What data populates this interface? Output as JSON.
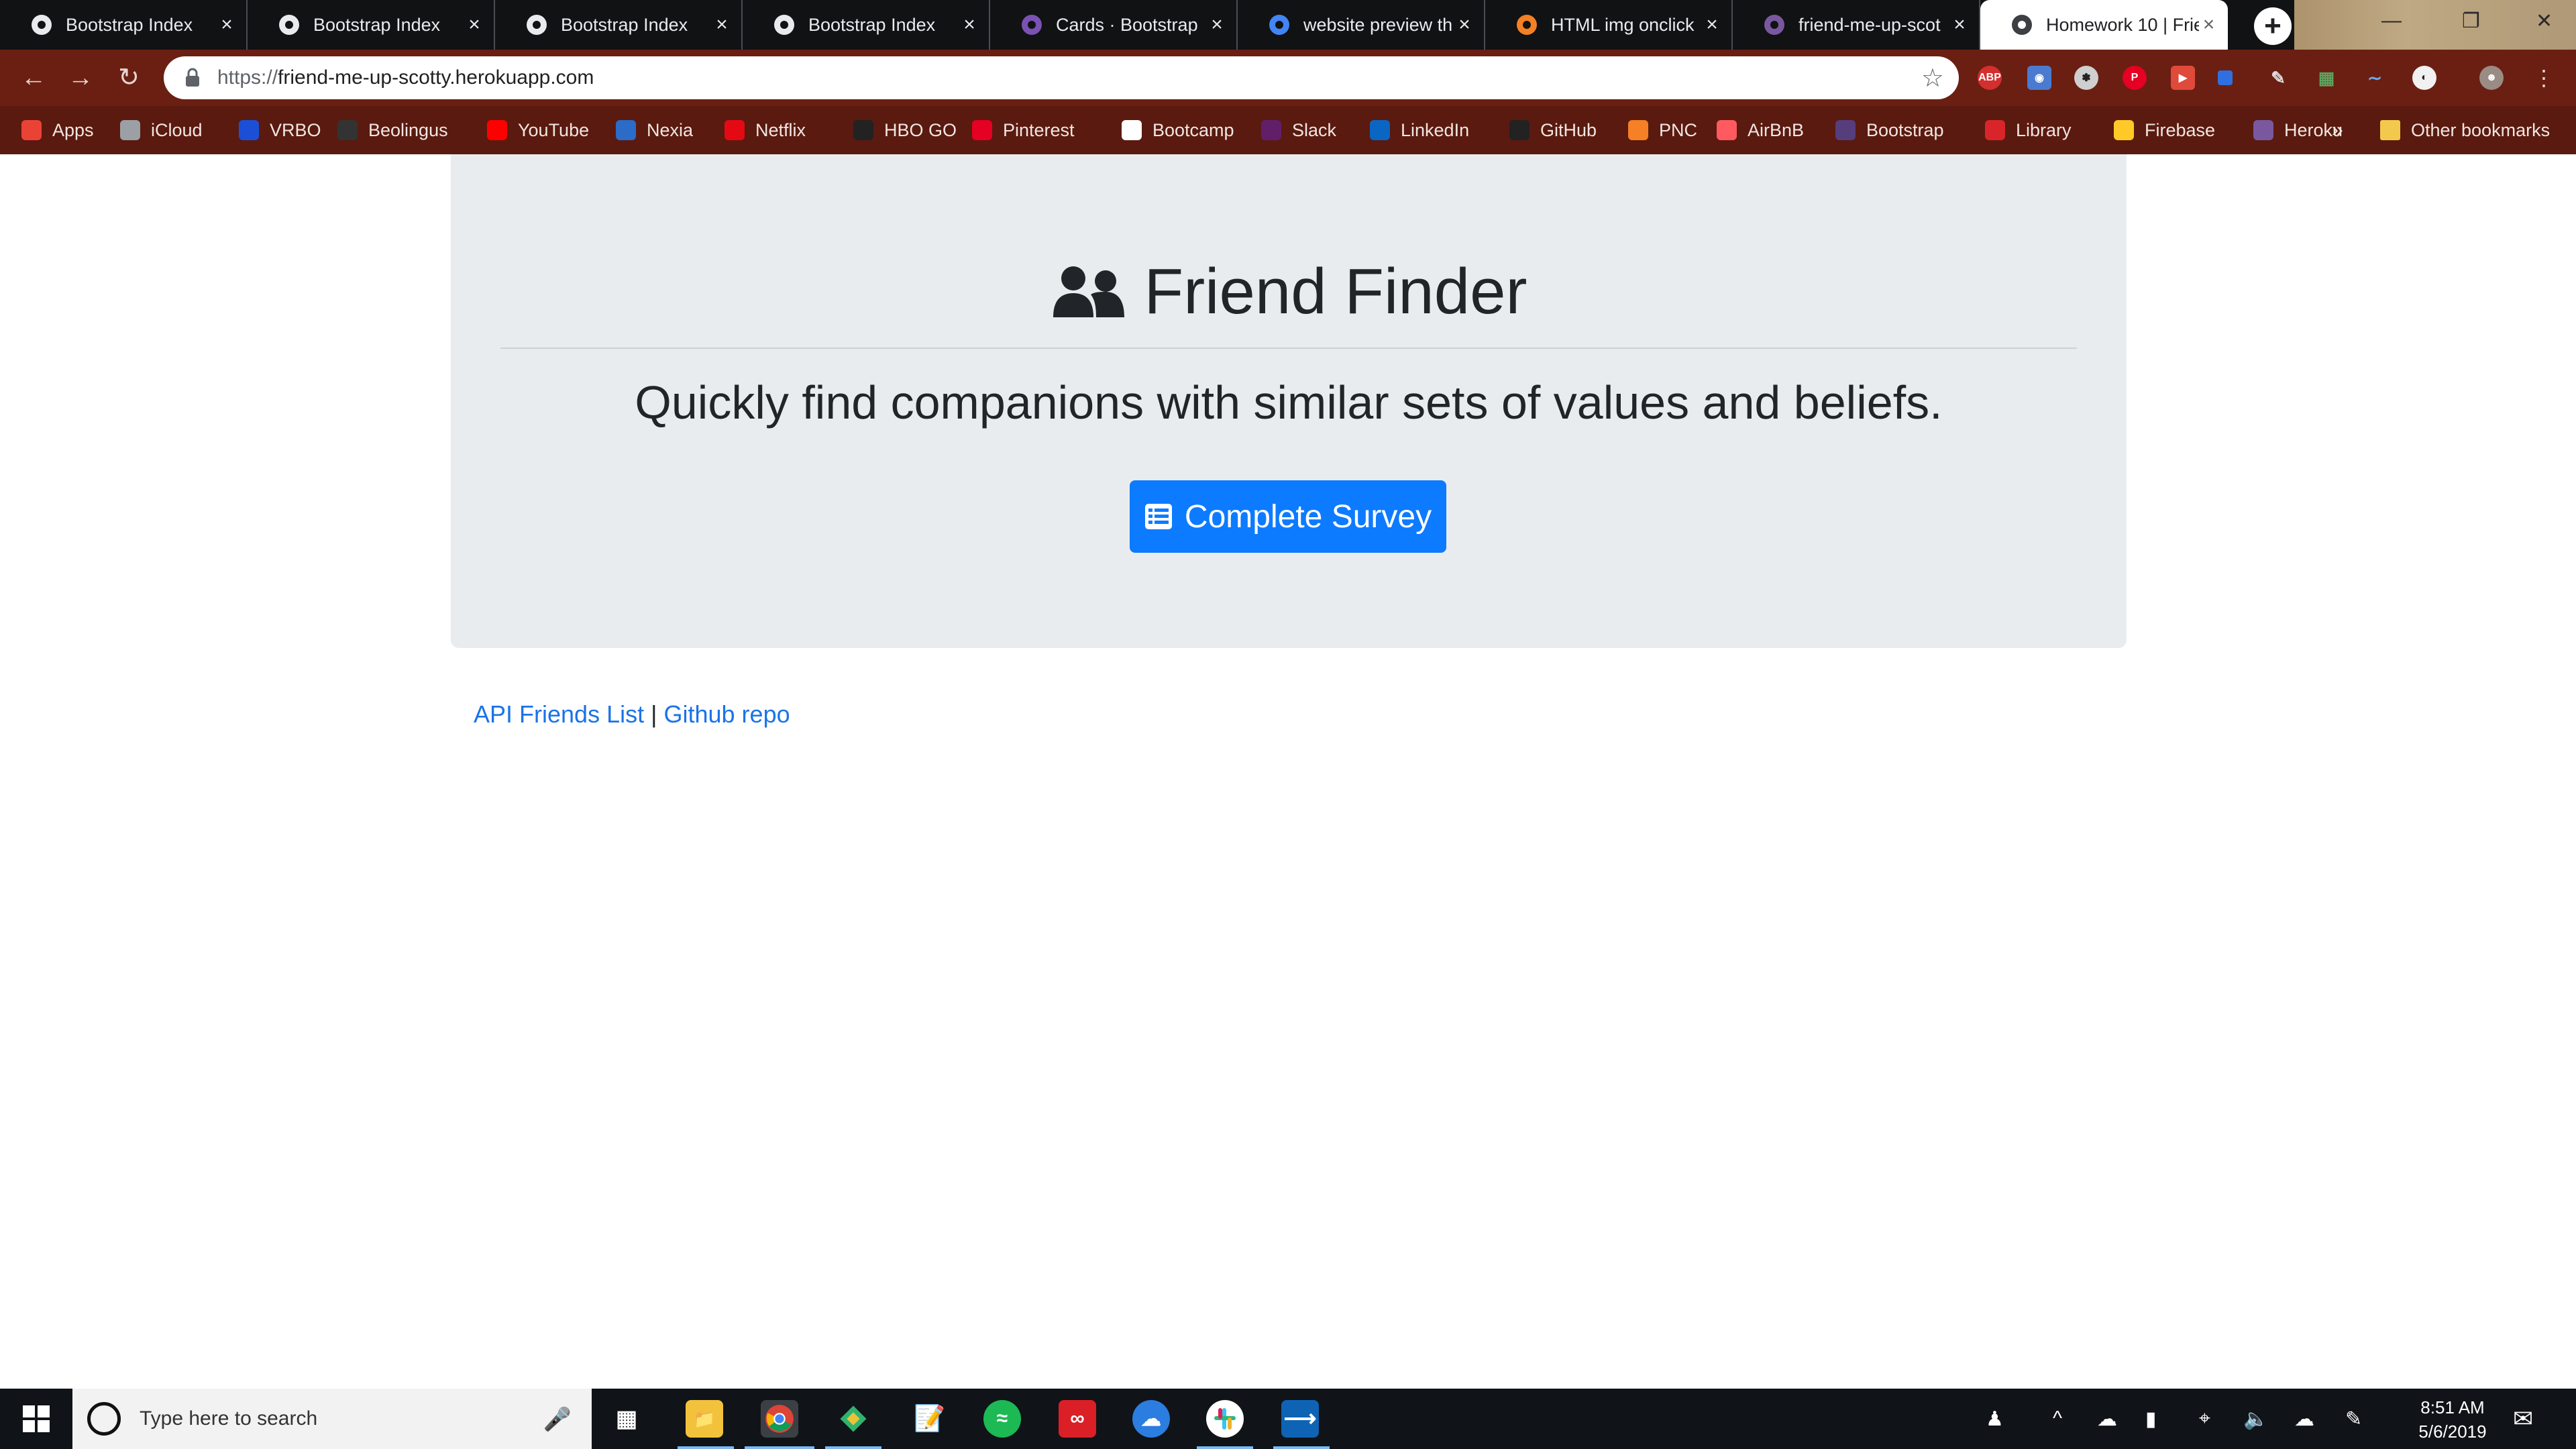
{
  "browser": {
    "tabs": [
      {
        "title": "Bootstrap Index",
        "icon": "globe-icon"
      },
      {
        "title": "Bootstrap Index",
        "icon": "globe-icon"
      },
      {
        "title": "Bootstrap Index",
        "icon": "globe-icon"
      },
      {
        "title": "Bootstrap Index",
        "icon": "globe-icon"
      },
      {
        "title": "Cards · Bootstrap",
        "icon": "bootstrap-icon"
      },
      {
        "title": "website preview th",
        "icon": "google-icon"
      },
      {
        "title": "HTML img onclick",
        "icon": "stackoverflow-icon"
      },
      {
        "title": "friend-me-up-scot",
        "icon": "heroku-icon"
      },
      {
        "title": "Homework 10 | Frie",
        "icon": "globe-icon",
        "active": true
      }
    ],
    "new_tab_label": "+",
    "url_scheme": "https://",
    "url_host": "friend-me-up-scotty.herokuapp.com",
    "bookmarks": [
      {
        "label": "Apps",
        "icon": "apps-grid-icon",
        "color": "#ea4335"
      },
      {
        "label": "iCloud",
        "icon": "apple-icon",
        "color": "#9aa0a6"
      },
      {
        "label": "VRBO",
        "icon": "vrbo-icon",
        "color": "#1c4fd8"
      },
      {
        "label": "Beolingus",
        "icon": "beolingus-icon",
        "color": "#333333"
      },
      {
        "label": "YouTube",
        "icon": "youtube-icon",
        "color": "#ff0000"
      },
      {
        "label": "Nexia",
        "icon": "nexia-icon",
        "color": "#2a6cc7"
      },
      {
        "label": "Netflix",
        "icon": "netflix-icon",
        "color": "#e50914"
      },
      {
        "label": "HBO GO",
        "icon": "hbo-icon",
        "color": "#222222"
      },
      {
        "label": "Pinterest",
        "icon": "pinterest-icon",
        "color": "#e60023"
      },
      {
        "label": "Bootcamp",
        "icon": "globe-icon",
        "color": "#ffffff"
      },
      {
        "label": "Slack",
        "icon": "slack-icon",
        "color": "#611f69"
      },
      {
        "label": "LinkedIn",
        "icon": "linkedin-icon",
        "color": "#0a66c2"
      },
      {
        "label": "GitHub",
        "icon": "github-icon",
        "color": "#222222"
      },
      {
        "label": "PNC",
        "icon": "pnc-icon",
        "color": "#f58025"
      },
      {
        "label": "AirBnB",
        "icon": "airbnb-icon",
        "color": "#ff5a5f"
      },
      {
        "label": "Bootstrap",
        "icon": "bootstrap-icon",
        "color": "#563d7c"
      },
      {
        "label": "Library",
        "icon": "library-icon",
        "color": "#d9252a"
      },
      {
        "label": "Firebase",
        "icon": "firebase-icon",
        "color": "#ffca28"
      },
      {
        "label": "Heroku",
        "icon": "heroku-icon",
        "color": "#79589f"
      }
    ],
    "bookmarks_overflow": "»",
    "other_bookmarks": "Other bookmarks"
  },
  "page": {
    "title": "Friend Finder",
    "lead": "Quickly find companions with similar sets of values and beliefs.",
    "survey_button": "Complete Survey",
    "link_api": "API Friends List",
    "link_separator": "|",
    "link_github": "Github repo",
    "button_color": "#0d7bff"
  },
  "taskbar": {
    "search_placeholder": "Type here to search",
    "time": "8:51 AM",
    "date": "5/6/2019"
  }
}
